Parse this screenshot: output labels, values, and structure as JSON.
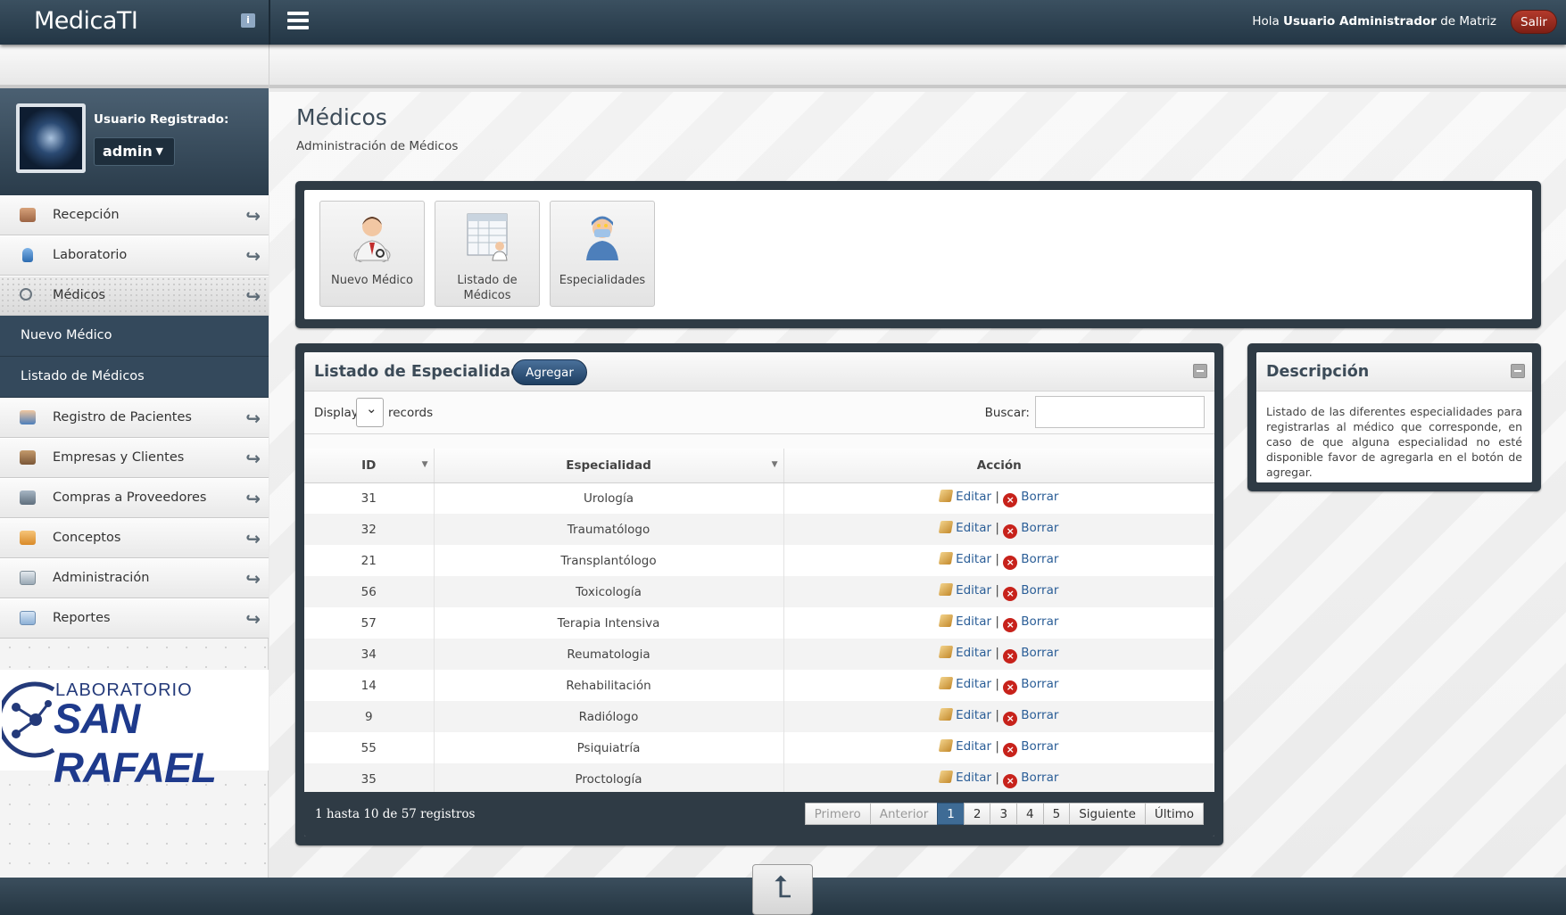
{
  "app": {
    "logo": "MedicaTI",
    "info_icon": "info-icon",
    "menu_icon": "hamburger-icon"
  },
  "header": {
    "greet_prefix": "Hola",
    "user_name": "Usuario Administrador",
    "greet_mid": "de",
    "branch": "Matriz",
    "logout": "Salir"
  },
  "user": {
    "label": "Usuario Registrado:",
    "selected": "admin"
  },
  "sidebar": {
    "items": [
      {
        "label": "Recepción",
        "icon": "sofa-icon"
      },
      {
        "label": "Laboratorio",
        "icon": "flask-icon"
      },
      {
        "label": "Médicos",
        "icon": "stethoscope-icon"
      },
      {
        "label": "Registro de Pacientes",
        "icon": "patient-icon"
      },
      {
        "label": "Empresas y Clientes",
        "icon": "building-icon"
      },
      {
        "label": "Compras a Proveedores",
        "icon": "cart-icon"
      },
      {
        "label": "Conceptos",
        "icon": "box-icon"
      },
      {
        "label": "Administración",
        "icon": "admin-icon"
      },
      {
        "label": "Reportes",
        "icon": "report-icon"
      }
    ],
    "submenu": [
      "Nuevo Médico",
      "Listado de Médicos"
    ]
  },
  "brand": {
    "line1": "LABORATORIO",
    "line2": "SAN RAFAEL"
  },
  "page": {
    "title": "Médicos",
    "subtitle": "Administración de Médicos"
  },
  "shortcuts": [
    {
      "label": "Nuevo Médico",
      "icon": "doctor-icon"
    },
    {
      "label": "Listado de Médicos",
      "icon": "doctor-list-icon"
    },
    {
      "label": "Especialidades",
      "icon": "surgeon-icon"
    }
  ],
  "list": {
    "title": "Listado de Especialidades",
    "add_label": "Agregar",
    "display_label": "Display",
    "records_label": "records",
    "search_label": "Buscar:",
    "columns": [
      "ID",
      "Especialidad",
      "Acción"
    ],
    "edit_label": "Editar",
    "sep": "|",
    "delete_label": "Borrar",
    "rows": [
      {
        "id": "31",
        "name": "Urología"
      },
      {
        "id": "32",
        "name": "Traumatólogo"
      },
      {
        "id": "21",
        "name": "Transplantólogo"
      },
      {
        "id": "56",
        "name": "Toxicología"
      },
      {
        "id": "57",
        "name": "Terapia Intensiva"
      },
      {
        "id": "34",
        "name": "Reumatologia"
      },
      {
        "id": "14",
        "name": "Rehabilitación"
      },
      {
        "id": "9",
        "name": "Radiólogo"
      },
      {
        "id": "55",
        "name": "Psiquiatría"
      },
      {
        "id": "35",
        "name": "Proctología"
      }
    ],
    "info": "1 hasta 10 de 57 registros",
    "pager": {
      "first": "Primero",
      "prev": "Anterior",
      "pages": [
        "1",
        "2",
        "3",
        "4",
        "5"
      ],
      "current": "1",
      "next": "Siguiente",
      "last": "Último"
    }
  },
  "description": {
    "title": "Descripción",
    "text": "Listado de las diferentes especialidades para registrarlas al médico que corresponde, en caso de que alguna especialidad no esté disponible favor de agregarla en el botón de agregar."
  },
  "colors": {
    "accent": "#3e6b95",
    "dark": "#2f3b45",
    "danger": "#c7221b"
  }
}
